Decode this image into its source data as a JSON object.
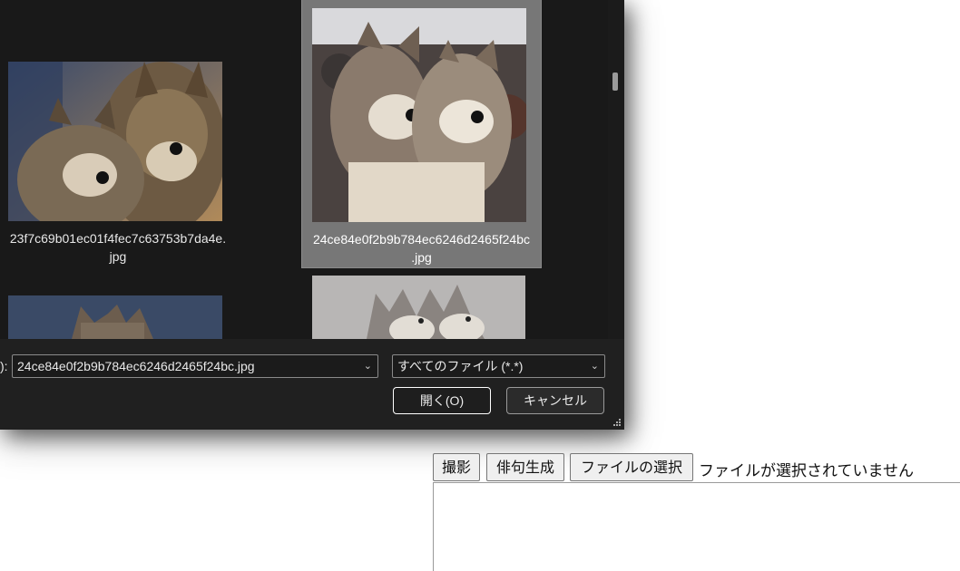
{
  "dialog": {
    "files": [
      {
        "name_line1": "23f7c69b01ec01f4fec7c63753b7da4e.",
        "name_line2": "jpg",
        "selected": false
      },
      {
        "name_line1": "24ce84e0f2b9b784ec6246d2465f24bc",
        "name_line2": ".jpg",
        "selected": true
      }
    ],
    "filename_label": "):",
    "filename_value": "24ce84e0f2b9b784ec6246d2465f24bc.jpg",
    "filetype_value": "すべてのファイル (*.*)",
    "open_button": "開く(O)",
    "cancel_button": "キャンセル"
  },
  "page": {
    "capture_button": "撮影",
    "haiku_button": "俳句生成",
    "file_select_button": "ファイルの選択",
    "no_file_text": "ファイルが選択されていません"
  },
  "icons": [
    "chevron-down-icon",
    "resize-grip-icon"
  ]
}
